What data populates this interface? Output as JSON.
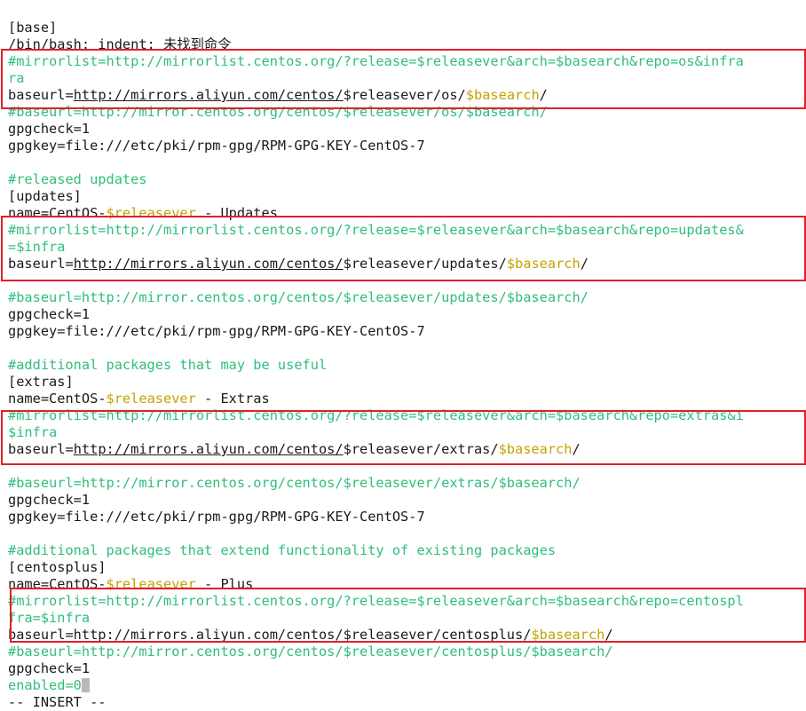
{
  "lines": [
    {
      "parts": [
        {
          "t": "[base]",
          "k": ""
        }
      ]
    },
    {
      "parts": [
        {
          "t": "/bin/bash: indent: 未找到命令",
          "k": ""
        }
      ]
    },
    {
      "parts": [
        {
          "t": "#mirrorlist=http://mirrorlist.centos.org/?release=$releasever&arch=$basearch&repo=os&infra",
          "k": "c"
        }
      ]
    },
    {
      "parts": [
        {
          "t": "ra",
          "k": "c"
        }
      ]
    },
    {
      "parts": [
        {
          "t": "baseurl=",
          "k": ""
        },
        {
          "t": "http://mirrors.aliyun.com/centos/",
          "k": "u"
        },
        {
          "t": "$releasever/os/",
          "k": ""
        },
        {
          "t": "$basearch",
          "k": "v"
        },
        {
          "t": "/",
          "k": ""
        }
      ]
    },
    {
      "parts": [
        {
          "t": "#baseurl=http://mirror.centos.org/centos/$releasever/os/$basearch/",
          "k": "c"
        }
      ]
    },
    {
      "parts": [
        {
          "t": "gpgcheck=1",
          "k": ""
        }
      ]
    },
    {
      "parts": [
        {
          "t": "gpgkey=file:///etc/pki/rpm-gpg/RPM-GPG-KEY-CentOS-7",
          "k": ""
        }
      ]
    },
    {
      "parts": [
        {
          "t": "",
          "k": ""
        }
      ]
    },
    {
      "parts": [
        {
          "t": "#released updates",
          "k": "c"
        }
      ]
    },
    {
      "parts": [
        {
          "t": "[updates]",
          "k": ""
        }
      ]
    },
    {
      "parts": [
        {
          "t": "name=CentOS-",
          "k": ""
        },
        {
          "t": "$releasever",
          "k": "v"
        },
        {
          "t": " - Updates",
          "k": ""
        }
      ]
    },
    {
      "parts": [
        {
          "t": "#mirrorlist=http://mirrorlist.centos.org/?release=$releasever&arch=$basearch&repo=updates&",
          "k": "c"
        }
      ]
    },
    {
      "parts": [
        {
          "t": "=$infra",
          "k": "c"
        }
      ]
    },
    {
      "parts": [
        {
          "t": "baseurl=",
          "k": ""
        },
        {
          "t": "http://mirrors.aliyun.com/centos/",
          "k": "u"
        },
        {
          "t": "$releasever/updates/",
          "k": ""
        },
        {
          "t": "$basearch",
          "k": "v"
        },
        {
          "t": "/",
          "k": ""
        }
      ]
    },
    {
      "parts": [
        {
          "t": "",
          "k": ""
        }
      ]
    },
    {
      "parts": [
        {
          "t": "#baseurl=http://mirror.centos.org/centos/$releasever/updates/$basearch/",
          "k": "c"
        }
      ]
    },
    {
      "parts": [
        {
          "t": "gpgcheck=1",
          "k": ""
        }
      ]
    },
    {
      "parts": [
        {
          "t": "gpgkey=file:///etc/pki/rpm-gpg/RPM-GPG-KEY-CentOS-7",
          "k": ""
        }
      ]
    },
    {
      "parts": [
        {
          "t": "",
          "k": ""
        }
      ]
    },
    {
      "parts": [
        {
          "t": "#additional packages that may be useful",
          "k": "c"
        }
      ]
    },
    {
      "parts": [
        {
          "t": "[extras]",
          "k": ""
        }
      ]
    },
    {
      "parts": [
        {
          "t": "name=CentOS-",
          "k": ""
        },
        {
          "t": "$releasever",
          "k": "v"
        },
        {
          "t": " - Extras",
          "k": ""
        }
      ]
    },
    {
      "parts": [
        {
          "t": "#mirrorlist=http://mirrorlist.centos.org/?release=$releasever&arch=$basearch&repo=extras&i",
          "k": "c"
        }
      ]
    },
    {
      "parts": [
        {
          "t": "$infra",
          "k": "c"
        }
      ]
    },
    {
      "parts": [
        {
          "t": "baseurl=",
          "k": ""
        },
        {
          "t": "http://mirrors.aliyun.com/centos/",
          "k": "u"
        },
        {
          "t": "$releasever/extras/",
          "k": ""
        },
        {
          "t": "$basearch",
          "k": "v"
        },
        {
          "t": "/",
          "k": ""
        }
      ]
    },
    {
      "parts": [
        {
          "t": "",
          "k": ""
        }
      ]
    },
    {
      "parts": [
        {
          "t": "#baseurl=http://mirror.centos.org/centos/$releasever/extras/$basearch/",
          "k": "c"
        }
      ]
    },
    {
      "parts": [
        {
          "t": "gpgcheck=1",
          "k": ""
        }
      ]
    },
    {
      "parts": [
        {
          "t": "gpgkey=file:///etc/pki/rpm-gpg/RPM-GPG-KEY-CentOS-7",
          "k": ""
        }
      ]
    },
    {
      "parts": [
        {
          "t": "",
          "k": ""
        }
      ]
    },
    {
      "parts": [
        {
          "t": "#additional packages that extend functionality of existing packages",
          "k": "c"
        }
      ]
    },
    {
      "parts": [
        {
          "t": "[centosplus]",
          "k": ""
        }
      ]
    },
    {
      "parts": [
        {
          "t": "name=CentOS-",
          "k": ""
        },
        {
          "t": "$releasever",
          "k": "v"
        },
        {
          "t": " - Plus",
          "k": ""
        }
      ]
    },
    {
      "parts": [
        {
          "t": "#mirrorlist=http://mirrorlist.centos.org/?release=$releasever&arch=$basearch&repo=centospl",
          "k": "c"
        }
      ]
    },
    {
      "parts": [
        {
          "t": "fra=$infra",
          "k": "c"
        }
      ]
    },
    {
      "parts": [
        {
          "t": "baseurl=http://mirrors.aliyun.com/centos/$releasever/centosplus/",
          "k": ""
        },
        {
          "t": "$basearch",
          "k": "v"
        },
        {
          "t": "/",
          "k": ""
        }
      ]
    },
    {
      "parts": [
        {
          "t": "#baseurl=http://mirror.centos.org/centos/$releasever/centosplus/$basearch/",
          "k": "c"
        }
      ]
    },
    {
      "parts": [
        {
          "t": "gpgcheck=1",
          "k": ""
        }
      ]
    },
    {
      "parts": [
        {
          "t": "enabled=0",
          "k": "c"
        }
      ],
      "cursor": true
    },
    {
      "parts": [
        {
          "t": "-- INSERT --",
          "k": ""
        }
      ]
    }
  ],
  "colors": {
    "comment": "#2fbe7d",
    "variable": "#c4a200",
    "text": "#1a1a1a",
    "highlight_box": "#e0202a",
    "cursor": "#b8b8b8"
  }
}
